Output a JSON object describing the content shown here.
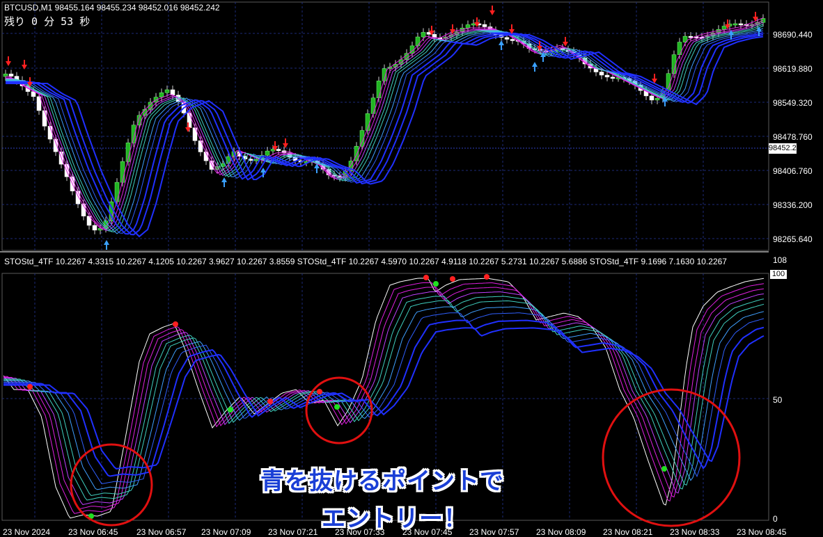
{
  "header": {
    "symbol_line": "BTCUSD,M1  98455.164 98455.234 98452.016 98452.242",
    "remaining": "残り 0 分 53 秒"
  },
  "price_axis": {
    "labels": [
      "98690.440",
      "98619.880",
      "98549.320",
      "98478.760",
      "98406.760",
      "98336.200",
      "98265.640"
    ],
    "current_price": "98452.242"
  },
  "indicator": {
    "title": "STOStd_4TF 10.2267 4.3315 10.2267 4.1205 10.2267 3.9627 10.2267 3.8559  STOStd_4TF 10.2267 4.5970 10.2267 4.9118 10.2267 5.2731 10.2267 5.6886  STOStd_4TF 9.1696 7.1630 10.2267",
    "axis_labels": [
      "108",
      "100",
      "50",
      "0"
    ]
  },
  "time_axis": {
    "labels": [
      "23 Nov 2024",
      "23 Nov 06:45",
      "23 Nov 06:57",
      "23 Nov 07:09",
      "23 Nov 07:21",
      "23 Nov 07:33",
      "23 Nov 07:45",
      "23 Nov 07:57",
      "23 Nov 08:09",
      "23 Nov 08:21",
      "23 Nov 08:33",
      "23 Nov 08:45"
    ]
  },
  "overlay": {
    "line1": "青を抜けるポイントで",
    "line2": "エントリー！"
  },
  "colors": {
    "background": "#000000",
    "grid": "#1c2a78",
    "bull_candle": "#22b422",
    "bear_candle": "#ffffff",
    "band_magenta": "#e020e0",
    "band_cyan": "#40d0c0",
    "band_blue": "#2030ff",
    "circle": "#e01010"
  }
}
